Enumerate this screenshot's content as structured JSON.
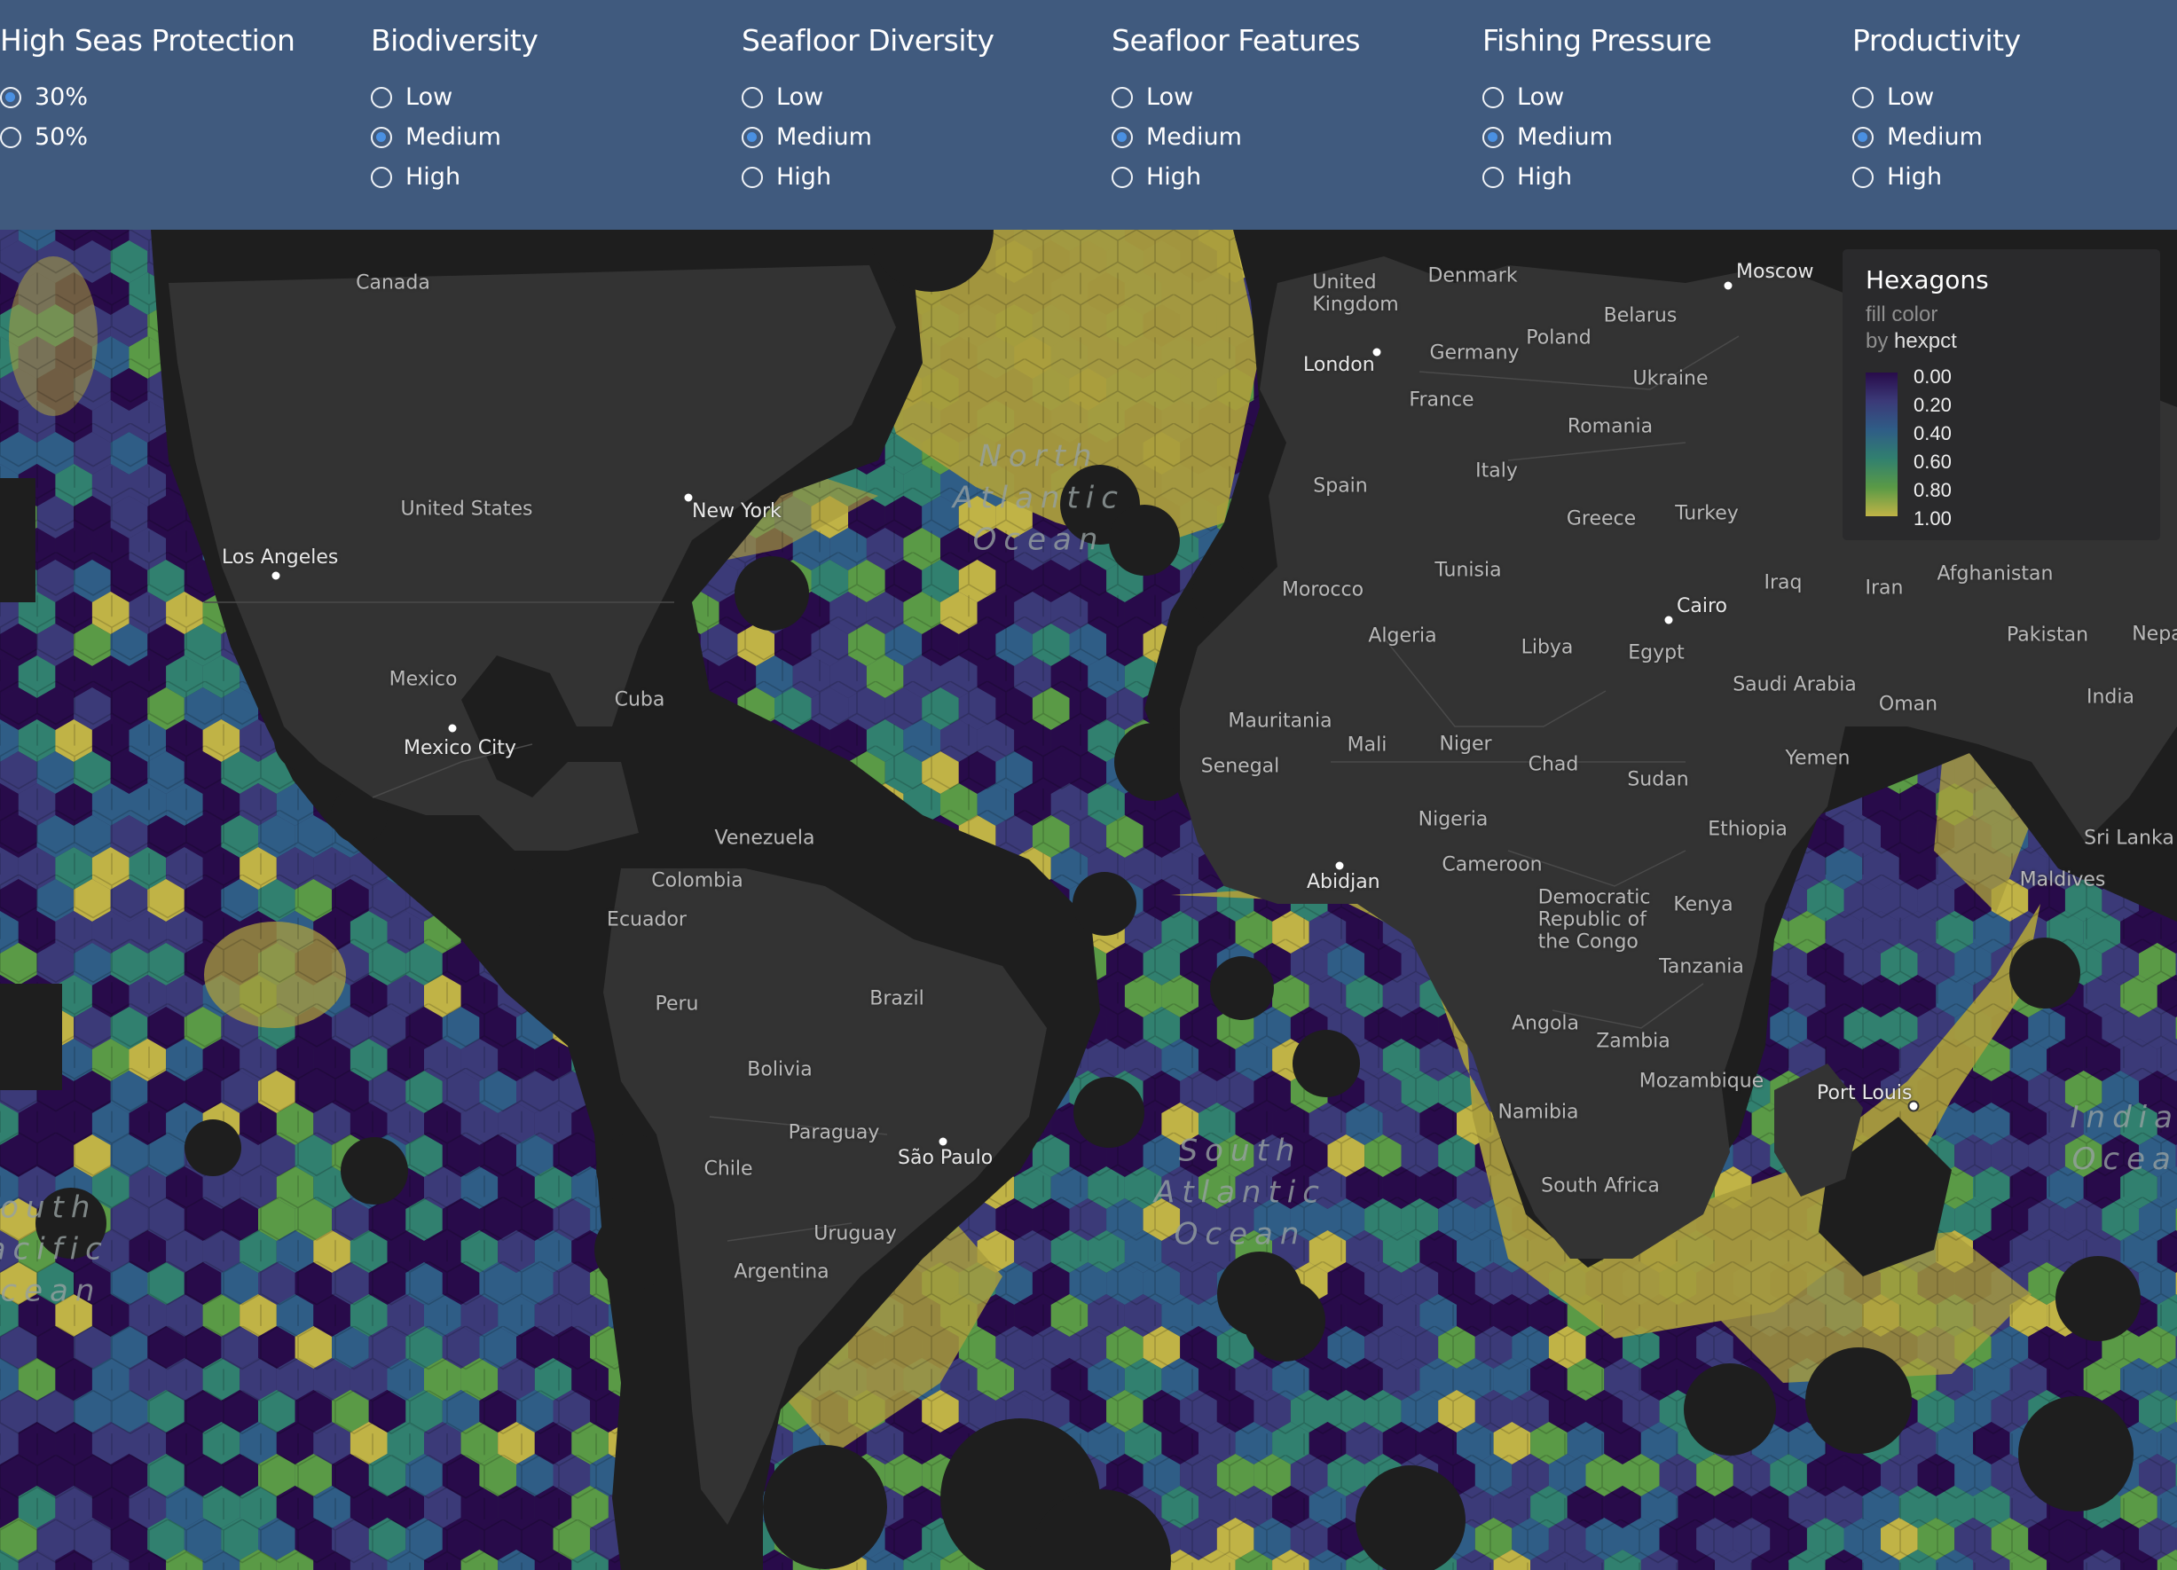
{
  "filters": [
    {
      "title": "High Seas Protection",
      "options": [
        "30%",
        "50%"
      ],
      "selected": 0
    },
    {
      "title": "Biodiversity",
      "options": [
        "Low",
        "Medium",
        "High"
      ],
      "selected": 1
    },
    {
      "title": "Seafloor Diversity",
      "options": [
        "Low",
        "Medium",
        "High"
      ],
      "selected": 1
    },
    {
      "title": "Seafloor Features",
      "options": [
        "Low",
        "Medium",
        "High"
      ],
      "selected": 1
    },
    {
      "title": "Fishing Pressure",
      "options": [
        "Low",
        "Medium",
        "High"
      ],
      "selected": 1
    },
    {
      "title": "Productivity",
      "options": [
        "Low",
        "Medium",
        "High"
      ],
      "selected": 1
    }
  ],
  "legend": {
    "title": "Hexagons",
    "subtitle_line1": "fill color",
    "subtitle_by": "by",
    "field": "hexpct",
    "ticks": [
      "0.00",
      "0.20",
      "0.40",
      "0.60",
      "0.80",
      "1.00"
    ],
    "colors": [
      "#280b4a",
      "#3b3a78",
      "#2f5d86",
      "#31806f",
      "#5a9a46",
      "#c0b346"
    ]
  },
  "map": {
    "countries": [
      "Canada",
      "United States",
      "Mexico",
      "Cuba",
      "Venezuela",
      "Colombia",
      "Ecuador",
      "Peru",
      "Brazil",
      "Bolivia",
      "Paraguay",
      "Chile",
      "Uruguay",
      "Argentina",
      "United Kingdom",
      "Denmark",
      "Belarus",
      "Poland",
      "Germany",
      "Ukraine",
      "France",
      "Romania",
      "Spain",
      "Italy",
      "Greece",
      "Turkey",
      "Morocco",
      "Tunisia",
      "Algeria",
      "Libya",
      "Egypt",
      "Iraq",
      "Iran",
      "Afghanistan",
      "Pakistan",
      "Nepal",
      "India",
      "Saudi Arabia",
      "Oman",
      "Yemen",
      "Mauritania",
      "Mali",
      "Niger",
      "Chad",
      "Sudan",
      "Senegal",
      "Nigeria",
      "Ethiopia",
      "Cameroon",
      "Democratic Republic of the Congo",
      "Kenya",
      "Tanzania",
      "Angola",
      "Zambia",
      "Mozambique",
      "Namibia",
      "South Africa",
      "Sri Lanka",
      "Maldives"
    ],
    "cities": [
      "New York",
      "Los Angeles",
      "Mexico City",
      "London",
      "Moscow",
      "Cairo",
      "Abidjan",
      "São Paulo",
      "Port Louis"
    ],
    "oceans": [
      "North Atlantic Ocean",
      "South Atlantic Ocean",
      "Indian Ocean",
      "South Pacific Ocean"
    ]
  }
}
